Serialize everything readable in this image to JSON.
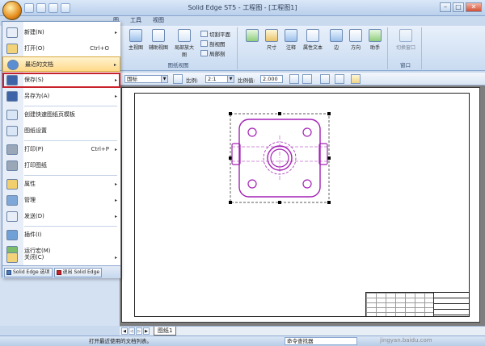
{
  "window": {
    "title": "Solid Edge ST5 - 工程图 - [工程图1]",
    "minimize": "–",
    "maximize": "□",
    "close": "✕"
  },
  "tabs": [
    "图",
    "工具",
    "视图"
  ],
  "ribbon": {
    "drawing_views_group": {
      "label": "图纸视图",
      "buttons": [
        "主视图",
        "辅助视图",
        "局部放大图"
      ],
      "small": [
        "切割平面",
        "剖视图",
        "局部剖"
      ]
    },
    "annotation_group": {
      "label": "",
      "buttons": [
        "尺寸",
        "注释",
        "属性文本",
        "边",
        "方向",
        "助手"
      ]
    },
    "window_group": {
      "label": "窗口",
      "buttons": [
        "切换窗口"
      ]
    }
  },
  "command_bar": {
    "standard": "国标",
    "scale_label": "比例:",
    "scale_value": "2:1",
    "ratio_label": "比例值:",
    "ratio_value": "2.000"
  },
  "app_menu": {
    "items": [
      {
        "label": "新建(N)",
        "shortcut": "",
        "arrow": "▸",
        "icon": "new-document-icon",
        "color": "#e8eef7"
      },
      {
        "label": "打开(O)",
        "shortcut": "Ctrl+O",
        "arrow": "",
        "icon": "open-folder-icon",
        "color": "#f3d37a"
      },
      {
        "label": "最近的文档",
        "shortcut": "",
        "arrow": "▸",
        "icon": "recent-docs-icon",
        "color": "#5b8fd1"
      },
      {
        "label": "保存(S)",
        "shortcut": "",
        "arrow": "▸",
        "icon": "save-disk-icon",
        "color": "#3e63a6"
      },
      {
        "label": "另存为(A)",
        "shortcut": "",
        "arrow": "▸",
        "icon": "save-as-icon",
        "color": "#3e63a6"
      },
      {
        "label": "创建快速图纸页模板",
        "shortcut": "",
        "arrow": "",
        "icon": "sheet-template-icon",
        "color": "#d9e6f5"
      },
      {
        "label": "图纸设置",
        "shortcut": "",
        "arrow": "",
        "icon": "sheet-setup-icon",
        "color": "#d9e6f5"
      },
      {
        "label": "打印(P)",
        "shortcut": "Ctrl+P",
        "arrow": "▸",
        "icon": "printer-icon",
        "color": "#9aa7b6"
      },
      {
        "label": "打印图纸",
        "shortcut": "",
        "arrow": "",
        "icon": "print-drawing-icon",
        "color": "#9aa7b6"
      },
      {
        "label": "属性",
        "shortcut": "",
        "arrow": "▸",
        "icon": "properties-icon",
        "color": "#f0cf6c"
      },
      {
        "label": "管理",
        "shortcut": "",
        "arrow": "▸",
        "icon": "manage-icon",
        "color": "#7fa8d8"
      },
      {
        "label": "发送(D)",
        "shortcut": "",
        "arrow": "▸",
        "icon": "send-mail-icon",
        "color": "#e7eef8"
      },
      {
        "label": "插件(I)",
        "shortcut": "",
        "arrow": "",
        "icon": "addin-icon",
        "color": "#6fa0d6"
      },
      {
        "label": "运行宏(M)",
        "shortcut": "",
        "arrow": "",
        "icon": "run-macro-icon",
        "color": "#7bbd6a"
      },
      {
        "label": "关闭(C)",
        "shortcut": "",
        "arrow": "▸",
        "icon": "close-folder-icon",
        "color": "#f3d37a"
      }
    ],
    "footer": {
      "options": "Solid Edge 选项",
      "exit": "退出 Solid Edge"
    }
  },
  "sheet_tab": "图纸1",
  "status": {
    "message": "打开最近使用的文档列表。",
    "command_finder": "命令查找器"
  },
  "watermark": "jingyan.baidu.com",
  "colors": {
    "accent": "#c8232b",
    "part_lines": "#a321b5"
  }
}
